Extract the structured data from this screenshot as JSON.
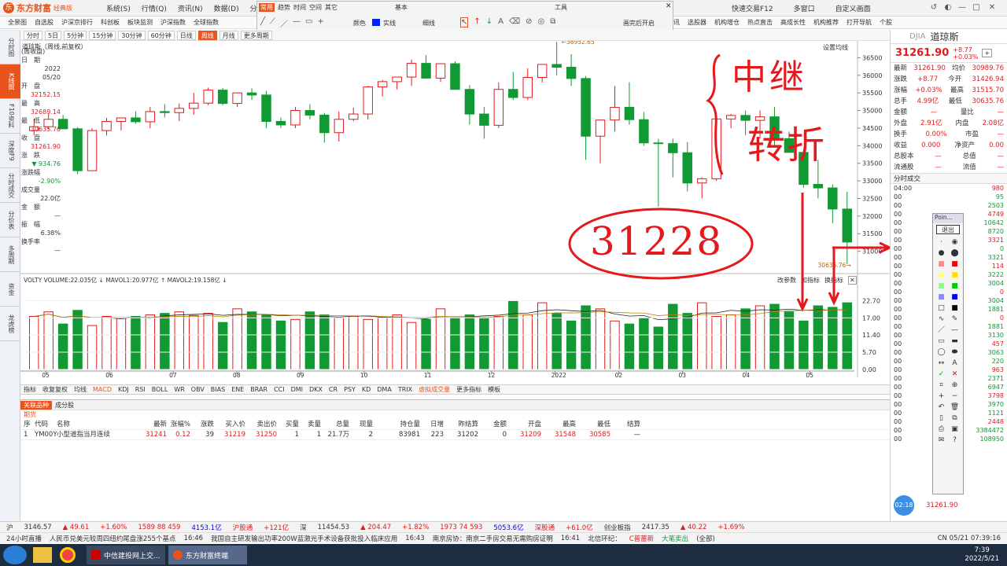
{
  "app": {
    "brand": "东方财富",
    "edition": "经典版"
  },
  "menu": [
    "系统(S)",
    "行情(Q)",
    "资讯(N)",
    "数据(D)",
    "分析(A)"
  ],
  "right_menu": [
    "快速交易F12",
    "多窗口",
    "自定义画面"
  ],
  "toolbar2": [
    "全景图",
    "自选股",
    "沪深京排行",
    "科创板",
    "板块监测",
    "沪深指数",
    "全球指数"
  ],
  "toolbar2_right": [
    "资讯",
    "选股器",
    "机构增仓",
    "热点直击",
    "高成长性",
    "机构推荐",
    "打开导航",
    "个股"
  ],
  "drawbar": {
    "tabs": [
      "常用",
      "趋势",
      "时间",
      "空间",
      "其它"
    ],
    "sections": [
      "基本",
      "工具"
    ],
    "color_label": "颜色",
    "line_label": "实线",
    "width_label": "细线",
    "auto_open": "画完后开启"
  },
  "periods": [
    "分时",
    "5日",
    "5分钟",
    "15分钟",
    "30分钟",
    "60分钟",
    "日线",
    "周线",
    "月线",
    "更多周期"
  ],
  "active_period": "周线",
  "chart_title": "道琼斯（周线,前复权）",
  "overlay_label": "设置均线",
  "left_nav": [
    "分时图",
    "K线图",
    "F10资料",
    "深度F9",
    "分时成交",
    "分价表",
    "多周期",
    "资金",
    "龙虎榜"
  ],
  "info": {
    "title": "(周收盘)",
    "date_label": "日　期",
    "date": "2022",
    "date2": "05/20",
    "open_label": "开　盘",
    "open": "32152.15",
    "high_label": "最　高",
    "high": "32689.14",
    "low_label": "最　低",
    "low": "30635.76",
    "close_label": "收　盘",
    "close": "31261.90",
    "chg_label": "涨　跌",
    "chg": "▼ 934.76",
    "pct_label": "涨跌幅",
    "pct": "-2.90%",
    "vol_label": "成交量",
    "vol": "22.0亿",
    "amt_label": "金　额",
    "amt": "—",
    "amp_label": "振　幅",
    "amp": "6.38%",
    "turn_label": "换手率",
    "turn": "—"
  },
  "chart_data": [
    {
      "type": "candlestick",
      "title": "",
      "ylim": [
        30500,
        36800
      ],
      "y_ticks": [
        31000,
        31500,
        32000,
        32500,
        33000,
        33500,
        34000,
        34500,
        35000,
        35500,
        36000,
        36500
      ],
      "x_tick_labels": [
        "05",
        "06",
        "07",
        "08",
        "09",
        "10",
        "11",
        "12",
        "2022",
        "02",
        "03",
        "04",
        "05"
      ],
      "candles": [
        [
          34430,
          34770,
          34300,
          34540
        ],
        [
          34540,
          34900,
          34460,
          34750
        ],
        [
          34750,
          34870,
          34520,
          34480
        ],
        [
          34480,
          34530,
          33190,
          33290
        ],
        [
          33290,
          34500,
          33280,
          34430
        ],
        [
          34430,
          34790,
          34290,
          34690
        ],
        [
          34690,
          34800,
          34430,
          34790
        ],
        [
          34790,
          34980,
          34620,
          34680
        ],
        [
          34680,
          35100,
          34500,
          34970
        ],
        [
          34970,
          35180,
          34800,
          34940
        ],
        [
          34940,
          35200,
          34700,
          35060
        ],
        [
          35060,
          35500,
          34880,
          35210
        ],
        [
          35210,
          35650,
          35150,
          35580
        ],
        [
          35580,
          35640,
          35150,
          35200
        ],
        [
          35200,
          35500,
          35100,
          35500
        ],
        [
          35500,
          35630,
          35300,
          35440
        ],
        [
          35440,
          35560,
          34500,
          34690
        ],
        [
          34690,
          34800,
          34500,
          34590
        ],
        [
          34590,
          35100,
          34500,
          35000
        ],
        [
          35000,
          35180,
          34750,
          34870
        ],
        [
          34870,
          34930,
          34090,
          34370
        ],
        [
          34370,
          34970,
          34120,
          34750
        ],
        [
          34750,
          35080,
          34700,
          34900
        ],
        [
          34900,
          35700,
          34740,
          35670
        ],
        [
          35670,
          35870,
          35400,
          35820
        ],
        [
          35820,
          35950,
          35600,
          35950
        ],
        [
          35950,
          36450,
          35700,
          36340
        ],
        [
          36340,
          36570,
          36020,
          35920
        ],
        [
          35920,
          36200,
          35810,
          36330
        ],
        [
          36330,
          36400,
          35710,
          35600
        ],
        [
          35600,
          35720,
          34600,
          34900
        ],
        [
          34900,
          35100,
          34200,
          34580
        ],
        [
          34580,
          35800,
          34500,
          35600
        ],
        [
          35600,
          36100,
          35300,
          35370
        ],
        [
          35370,
          36200,
          35300,
          35940
        ],
        [
          35940,
          36200,
          35800,
          36310
        ],
        [
          36310,
          36952,
          36000,
          36230
        ],
        [
          36230,
          36600,
          35700,
          35910
        ],
        [
          35910,
          35980,
          33600,
          34270
        ],
        [
          34270,
          34400,
          33500,
          34730
        ],
        [
          34730,
          35700,
          34400,
          35090
        ],
        [
          35090,
          35800,
          34600,
          34740
        ],
        [
          34740,
          34960,
          34000,
          34080
        ],
        [
          34080,
          34200,
          32272,
          34060
        ],
        [
          34060,
          34200,
          33100,
          33800
        ],
        [
          33800,
          34100,
          32700,
          32940
        ],
        [
          32940,
          33100,
          32500,
          33060
        ],
        [
          33060,
          34750,
          33000,
          34760
        ],
        [
          34760,
          34900,
          34500,
          34860
        ],
        [
          34860,
          35000,
          34300,
          34720
        ],
        [
          34720,
          35000,
          34200,
          34820
        ],
        [
          34820,
          35100,
          34000,
          34200
        ],
        [
          34200,
          34400,
          33800,
          33810
        ],
        [
          33810,
          33900,
          32800,
          32900
        ],
        [
          32900,
          33600,
          32500,
          32800
        ],
        [
          32800,
          32900,
          31800,
          32200
        ],
        [
          32200,
          32689,
          30635,
          31262
        ]
      ],
      "annotations": [
        {
          "text": "36952.65",
          "at": 36952.65
        },
        {
          "text": "30635.76",
          "at": 30635.76
        }
      ]
    },
    {
      "type": "bar",
      "title": "VOLTY VOLUME:22.035亿 ↓ MAVOL1:20.977亿 ↑ MAVOL2:19.158亿 ↓",
      "ylim": [
        0,
        28
      ],
      "y_ticks": [
        0,
        5.7,
        11.4,
        17,
        22.7
      ],
      "y_tick_labels": [
        "0.00",
        "5.70",
        "11.40",
        "17.00",
        "22.70"
      ],
      "values": [
        17.5,
        19,
        15,
        19.5,
        14.5,
        17.5,
        17,
        17.5,
        18,
        18.5,
        19,
        17.8,
        18.5,
        15.5,
        20,
        19,
        18,
        16,
        16.5,
        19,
        18,
        17,
        17.5,
        16.5,
        17.2,
        18,
        15.5,
        16.5,
        20,
        17,
        18,
        17,
        17.5,
        22.5,
        18,
        22,
        18.5,
        16,
        21,
        20,
        16,
        15,
        17,
        14,
        21.5,
        18.5,
        22,
        17.5,
        18,
        20,
        21,
        21.5,
        19,
        16,
        21,
        20.5,
        22
      ]
    }
  ],
  "vol_controls": [
    "改参数",
    "加指标",
    "换指标"
  ],
  "indicator_tabs": [
    "指标",
    "收复复权",
    "均线",
    "MACD",
    "KDJ",
    "RSI",
    "BOLL",
    "WR",
    "OBV",
    "BIAS",
    "ENE",
    "BRAR",
    "CCI",
    "DMI",
    "DKX",
    "CR",
    "PSY",
    "KD",
    "DMA",
    "TRIX",
    "虚拟成交量",
    "更多指标",
    "模板"
  ],
  "related": {
    "tabs": [
      "关联品种",
      "成分股"
    ],
    "subtitle": "期货",
    "headers": [
      "序",
      "代码",
      "名称",
      "最新",
      "涨幅%",
      "涨跌",
      "买入价",
      "卖出价",
      "买量",
      "卖量",
      "总量",
      "现量",
      "持仓量",
      "日增",
      "昨结算",
      "金额",
      "开盘",
      "最高",
      "最低",
      "结算"
    ],
    "rows": [
      [
        "1",
        "YM00Y",
        "小型道指当月连续",
        "31241",
        "0.12",
        "39",
        "31219",
        "31250",
        "1",
        "1",
        "21.7万",
        "2",
        "83981",
        "223",
        "31202",
        "0",
        "31209",
        "31548",
        "30585",
        "—"
      ]
    ]
  },
  "quote": {
    "code": "DJIA",
    "name": "道琼斯",
    "price": "31261.90",
    "chg": "+8.77",
    "pct": "+0.03%",
    "rows": [
      [
        "最新",
        "31261.90",
        "均价",
        "30989.76"
      ],
      [
        "涨跌",
        "+8.77",
        "今开",
        "31426.94"
      ],
      [
        "涨幅",
        "+0.03%",
        "最高",
        "31515.70"
      ],
      [
        "总手",
        "4.99亿",
        "最低",
        "30635.76"
      ],
      [
        "金额",
        "—",
        "量比",
        "—"
      ],
      [
        "外盘",
        "2.91亿",
        "内盘",
        "2.08亿"
      ],
      [
        "换手",
        "0.00%",
        "市盈",
        "—"
      ],
      [
        "收益",
        "0.000",
        "净资产",
        "0.00"
      ],
      [
        "总股本",
        "—",
        "总值",
        "—"
      ],
      [
        "流通股",
        "—",
        "流值",
        "—"
      ]
    ],
    "ticks_title": "分时成交",
    "ticks": [
      [
        "04:00",
        "980"
      ],
      [
        "00",
        "95"
      ],
      [
        "00",
        "2503"
      ],
      [
        "00",
        "4749"
      ],
      [
        "00",
        "10642"
      ],
      [
        "00",
        "8720"
      ],
      [
        "00",
        "3321"
      ],
      [
        "00",
        "0"
      ],
      [
        "00",
        "3321"
      ],
      [
        "00",
        "114"
      ],
      [
        "00",
        "3222"
      ],
      [
        "00",
        "3004"
      ],
      [
        "00",
        "0"
      ],
      [
        "00",
        "3004"
      ],
      [
        "00",
        "1881"
      ],
      [
        "00",
        "0"
      ],
      [
        "00",
        "1881"
      ],
      [
        "00",
        "3130"
      ],
      [
        "00",
        "457"
      ],
      [
        "00",
        "3063"
      ],
      [
        "00",
        "220"
      ],
      [
        "00",
        "963"
      ],
      [
        "00",
        "2371"
      ],
      [
        "00",
        "6947"
      ],
      [
        "00",
        "3798"
      ],
      [
        "00",
        "3970"
      ],
      [
        "00",
        "1121"
      ],
      [
        "00",
        "2448"
      ],
      [
        "00",
        "3384472"
      ],
      [
        "00",
        "108950"
      ]
    ],
    "bottom_price": "31261.90"
  },
  "toolbox": {
    "title": "Poin...",
    "exit": "退出"
  },
  "handwriting": {
    "top": "中继",
    "mid": "转折",
    "circle": "31228"
  },
  "status": {
    "sh_label": "沪",
    "sh": "3146.57",
    "sh_chg": "▲ 49.61",
    "sh_pct": "+1.60%",
    "sh_vol": "1589 88 459",
    "sh_amt": "4153.1亿",
    "hgt_label": "沪股通",
    "hgt": "+121亿",
    "sz_label": "深",
    "sz": "11454.53",
    "sz_chg": "▲ 204.47",
    "sz_pct": "+1.82%",
    "sz_vol": "1973 74 593",
    "sz_amt": "5053.6亿",
    "sgt_label": "深股通",
    "sgt": "+61.0亿",
    "cy_label": "创业板指",
    "cy": "2417.35",
    "cy_chg": "▲ 40.22",
    "cy_pct": "+1.69%"
  },
  "news": [
    "24小时直播",
    "人民币兑美元较周四纽约尾盘涨255个基点",
    "16:46",
    "我国自主研发输出功率200W蓝激光手术设备获批投入临床应用",
    "16:43",
    "南京房协：南京二手房交易无需购房证明",
    "16:41",
    "北信环纪：",
    "C普蔷新",
    "大笔卖出",
    "(全部)"
  ],
  "tray": {
    "time": "7:39",
    "date": "2022/5/21",
    "lang": "CN",
    "clock": "05/21 07:39:16",
    "badge": "02:18"
  },
  "taskbar": [
    "中信建投网上交...",
    "东方财富终端"
  ]
}
